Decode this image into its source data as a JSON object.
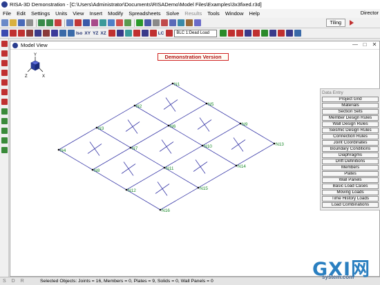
{
  "window": {
    "title": "RISA-3D Demonstration - [C:\\Users\\Administrator\\Documents\\RISADemo\\Model Files\\Examples\\3x3fixed.r3d]"
  },
  "menu": {
    "items": [
      "File",
      "Edit",
      "Settings",
      "Units",
      "View",
      "Insert",
      "Modify",
      "Spreadsheets",
      "Solve",
      "Results",
      "Tools",
      "Window",
      "Help"
    ],
    "disabled_index": 9,
    "right_label": "Director"
  },
  "toolbar": {
    "tiling_label": "Tiling",
    "text_buttons": [
      "Iso",
      "XY",
      "YZ",
      "XZ"
    ],
    "lc_label": "LC",
    "load_case_value": "BLC 1:Dead Load"
  },
  "model_view": {
    "title": "Model View",
    "banner": "Demonstration Version",
    "axes": [
      "Y",
      "Z",
      "X"
    ],
    "node_labels": [
      "N1",
      "N2",
      "N3",
      "N4",
      "N5",
      "N6",
      "N7",
      "N8",
      "N9",
      "N10",
      "N11",
      "N12",
      "N13",
      "N14",
      "N15",
      "N16"
    ]
  },
  "data_entry": {
    "title": "Data Entry",
    "buttons": [
      "Project Grid",
      "Materials",
      "Section Sets",
      "Member Design Rules",
      "Wall Design Rules",
      "Seismic Design Rules",
      "Connection Rules",
      "Joint Coordinates",
      "Boundary Conditions",
      "Diaphragms",
      "Drift Definitions",
      "Members",
      "Plates",
      "Wall Panels",
      "Basic Load Cases",
      "Moving Loads",
      "Time History Loads",
      "Load Combinations"
    ]
  },
  "status": {
    "tabs": "S D R",
    "selected_objects": "Selected Objects: Joints = 16, Members = 0, Plates = 9, Solids = 0, Wall Panels = 0"
  },
  "watermark": {
    "main": "GXI网",
    "sub": "system.com"
  },
  "colors": {
    "mesh_line": "#3a3aa8",
    "node_label": "#1a8a2a",
    "banner_border": "#d02020",
    "axis_cube": "#2a3d9a"
  },
  "icons": {
    "toolbar_1": [
      "new-icon",
      "open-icon",
      "save-icon",
      "print-icon",
      "undo-icon",
      "redo-icon",
      "grid-icon",
      "spreadsheet-icon",
      "solve-icon",
      "results-icon"
    ],
    "toolbar_2": [
      "view-icon",
      "rotate-icon",
      "pan-icon",
      "zoom-icon",
      "render-icon",
      "loads-icon",
      "graphic-select-icon"
    ],
    "left_toolbar": [
      "select-icon",
      "unselect-icon",
      "box-select-icon",
      "polygon-select-icon",
      "line-select-icon",
      "lock-icon",
      "draw-members-icon",
      "draw-plates-icon",
      "boundary-icon",
      "load-icon",
      "delete-icon",
      "modify-icon"
    ]
  }
}
